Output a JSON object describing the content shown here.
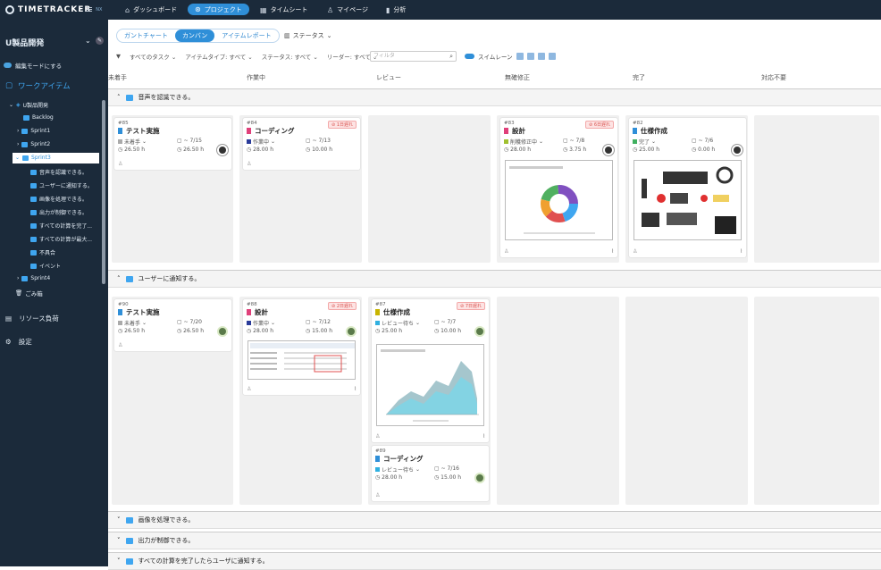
{
  "app": {
    "logo": "TIMETRACKER",
    "logo_suffix": "NX"
  },
  "nav": {
    "dashboard": "ダッシュボード",
    "project": "プロジェクト",
    "timesheet": "タイムシート",
    "mypage": "マイページ",
    "analysis": "分析"
  },
  "sidebar": {
    "project_title": "U製品開発",
    "edit_mode": "編集モードにする",
    "work_items": "ワークアイテム",
    "tree": [
      {
        "label": "U製品開発"
      },
      {
        "label": "Backlog"
      },
      {
        "label": "Sprint1"
      },
      {
        "label": "Sprint2"
      },
      {
        "label": "Sprint3"
      },
      {
        "label": "音声を認識できる。"
      },
      {
        "label": "ユーザーに通知する。"
      },
      {
        "label": "画像を処理できる。"
      },
      {
        "label": "出力が制御できる。"
      },
      {
        "label": "すべての計算を完了..."
      },
      {
        "label": "すべての計算が最大..."
      },
      {
        "label": "不具合"
      },
      {
        "label": "イベント"
      },
      {
        "label": "Sprint4"
      }
    ],
    "trash": "ごみ箱",
    "resource": "リソース負荷",
    "settings": "設定"
  },
  "toolbar": {
    "tabs": [
      "ガントチャート",
      "カンバン",
      "アイテムレポート"
    ],
    "status_select": "ステータス",
    "filters": [
      "すべてのタスク",
      "アイテムタイプ: すべて",
      "ステータス: すべて",
      "リーダー: すべて"
    ],
    "search_placeholder": "フィルタ",
    "swimlane": "スイムレーン"
  },
  "columns": [
    "未着手",
    "作業中",
    "レビュー",
    "無確修正",
    "完了",
    "対応不要"
  ],
  "lanes": [
    "音声を認識できる。",
    "ユーザーに通知する。",
    "画像を処理できる。",
    "出力が制御できる。",
    "すべての計算を完了したらユーザに通知する。"
  ],
  "cards": {
    "c85": {
      "id": "#85",
      "title": "テスト実施",
      "status": "未着手",
      "date": "~ 7/15",
      "e1": "26.50 h",
      "e2": "26.50 h"
    },
    "c84": {
      "id": "#84",
      "title": "コーディング",
      "delay": "1日遅れ",
      "status": "作業中",
      "date": "~ 7/13",
      "e1": "28.00 h",
      "e2": "10.00 h"
    },
    "c83": {
      "id": "#83",
      "title": "設計",
      "delay": "6日遅れ",
      "status": "削穫修正中",
      "date": "~ 7/8",
      "e1": "28.00 h",
      "e2": "3.75 h"
    },
    "c82": {
      "id": "#82",
      "title": "仕様作成",
      "status": "完了",
      "date": "~ 7/6",
      "e1": "25.00 h",
      "e2": "0.00 h"
    },
    "c90": {
      "id": "#90",
      "title": "テスト実施",
      "status": "未着手",
      "date": "~ 7/20",
      "e1": "26.50 h",
      "e2": "26.50 h"
    },
    "c88": {
      "id": "#88",
      "title": "設計",
      "delay": "2日遅れ",
      "status": "作業中",
      "date": "~ 7/12",
      "e1": "28.00 h",
      "e2": "15.00 h"
    },
    "c87": {
      "id": "#87",
      "title": "仕様作成",
      "delay": "7日遅れ",
      "status": "レビュー待ち",
      "date": "~ 7/7",
      "e1": "25.00 h",
      "e2": "10.00 h"
    },
    "c89": {
      "id": "#89",
      "title": "コーディング",
      "status": "レビュー待ち",
      "date": "~ 7/16",
      "e1": "28.00 h",
      "e2": "15.00 h"
    }
  },
  "colors": {
    "nav_bg": "#1b2a3a",
    "accent": "#2f8fd8",
    "delay_bg": "#fde3e3",
    "delay_fg": "#d9534f"
  }
}
